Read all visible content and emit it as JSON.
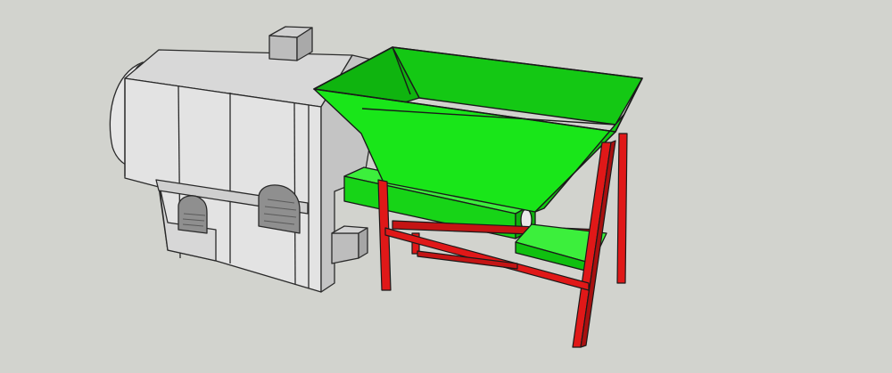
{
  "scene": {
    "description_visible_text": [],
    "colors": {
      "background": "#d2d3ce",
      "machine_light": "#e4e4e4",
      "machine_mid": "#c9c9c9",
      "machine_dark": "#a9a9a9",
      "edge": "#2a2a2a",
      "hopper_green": "#19e619",
      "hopper_green_dark": "#0fbf0f",
      "hopper_green_light": "#47f047",
      "frame_red": "#e01818",
      "frame_red_dark": "#a81010"
    },
    "objects": [
      "drum-dryer-machine",
      "feed-hopper",
      "support-frame",
      "conveyor-chute"
    ]
  }
}
